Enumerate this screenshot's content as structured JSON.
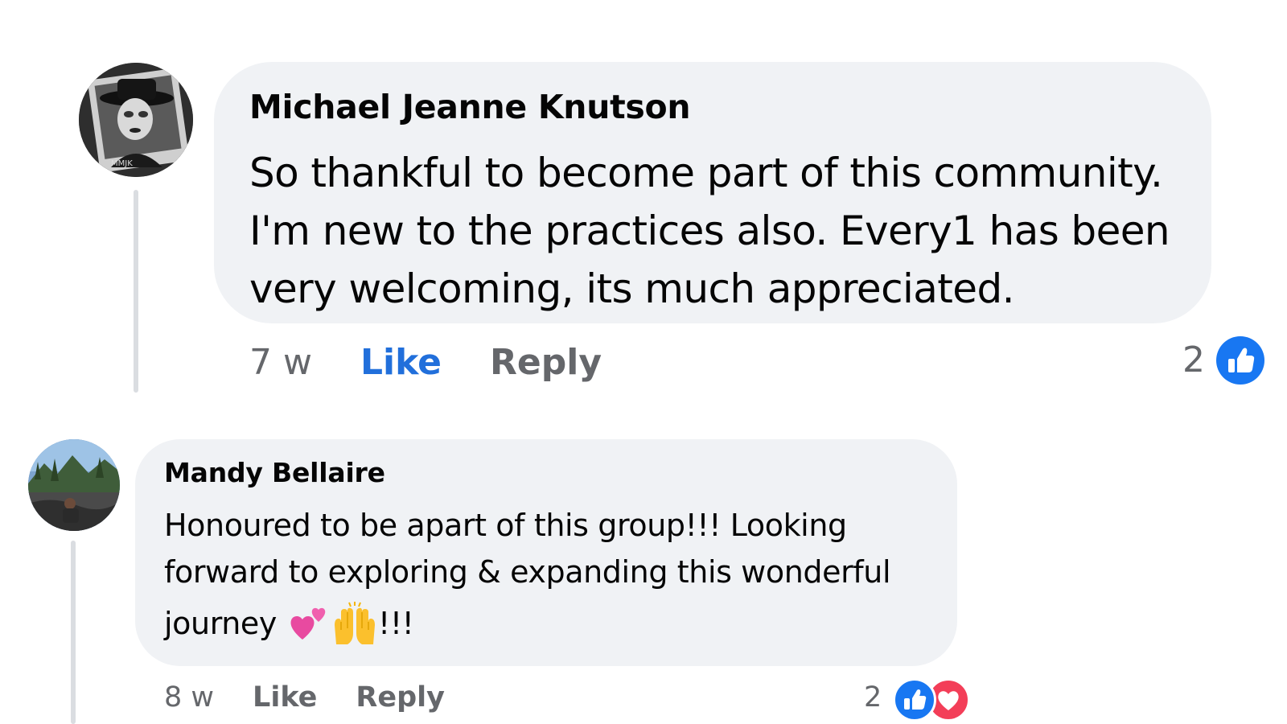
{
  "comments": [
    {
      "author": "Michael Jeanne Knutson",
      "text_lines": [
        "So thankful to become part of this community.",
        "I'm new to the practices also. Every1 has been",
        "very welcoming, its much appreciated."
      ],
      "time": "7 w",
      "like_label": "Like",
      "reply_label": "Reply",
      "reaction_count": "2",
      "reactions": [
        "like-icon"
      ],
      "like_active": true
    },
    {
      "author": "Mandy Bellaire",
      "text_lines": [
        "Honoured to be apart of this group!!! Looking",
        "forward to exploring & expanding this wonderful",
        "journey"
      ],
      "text_suffix": "!!!",
      "emojis": [
        "two-hearts-icon",
        "raising-hands-icon"
      ],
      "time": "8 w",
      "like_label": "Like",
      "reply_label": "Reply",
      "reaction_count": "2",
      "reactions": [
        "like-icon",
        "love-icon"
      ],
      "like_active": false
    }
  ],
  "colors": {
    "bubble": "#f0f2f5",
    "link_blue": "#216fdb",
    "meta_gray": "#65676b",
    "like_badge": "#1877f2",
    "love_badge": "#f33e58"
  }
}
